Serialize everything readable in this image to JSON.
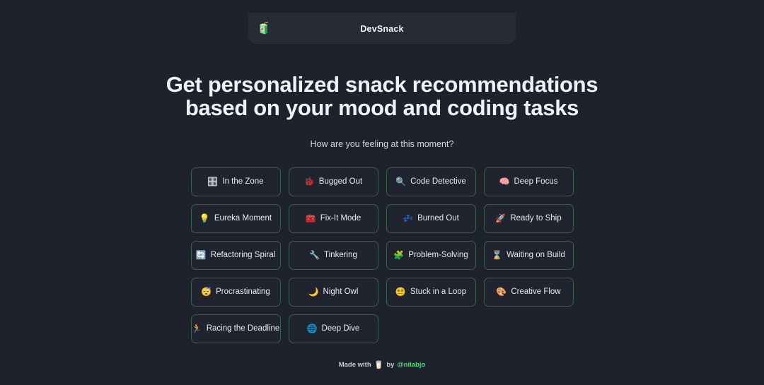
{
  "header": {
    "brand_icon": "snack-bag-emoji",
    "brand_icon_glyph": "🧃",
    "title": "DevSnack",
    "bar_color": "#272b35"
  },
  "hero": {
    "title_line1": "Get personalized snack recommendations",
    "title_line2": "based on your mood and coding tasks",
    "subtitle": "How are you feeling at this moment?"
  },
  "theme": {
    "background": "#1e222b",
    "button_background": "#20242e",
    "button_border": "#35614a",
    "accent_green": "#4ade80",
    "text_primary": "#eef1f7"
  },
  "moods": [
    {
      "label": "In the Zone",
      "icon_name": "control-knobs-icon",
      "glyph": "🎛️"
    },
    {
      "label": "Bugged Out",
      "icon_name": "lady-beetle-icon",
      "glyph": "🐞"
    },
    {
      "label": "Code Detective",
      "icon_name": "magnifying-glass-icon",
      "glyph": "🔍"
    },
    {
      "label": "Deep Focus",
      "icon_name": "brain-icon",
      "glyph": "🧠"
    },
    {
      "label": "Eureka Moment",
      "icon_name": "light-bulb-icon",
      "glyph": "💡"
    },
    {
      "label": "Fix-It Mode",
      "icon_name": "toolbox-icon",
      "glyph": "🧰"
    },
    {
      "label": "Burned Out",
      "icon_name": "zzz-sleep-icon",
      "glyph": "💤"
    },
    {
      "label": "Ready to Ship",
      "icon_name": "rocket-icon",
      "glyph": "🚀"
    },
    {
      "label": "Refactoring Spiral",
      "icon_name": "counterclockwise-arrows-icon",
      "glyph": "🔄"
    },
    {
      "label": "Tinkering",
      "icon_name": "wrench-icon",
      "glyph": "🔧"
    },
    {
      "label": "Problem-Solving",
      "icon_name": "puzzle-piece-icon",
      "glyph": "🧩"
    },
    {
      "label": "Waiting on Build",
      "icon_name": "hourglass-icon",
      "glyph": "⌛"
    },
    {
      "label": "Procrastinating",
      "icon_name": "sleeping-face-icon",
      "glyph": "😴"
    },
    {
      "label": "Night Owl",
      "icon_name": "crescent-moon-icon",
      "glyph": "🌙"
    },
    {
      "label": "Stuck in a Loop",
      "icon_name": "dizzy-face-icon",
      "glyph": "😵‍💫"
    },
    {
      "label": "Creative Flow",
      "icon_name": "artist-palette-icon",
      "glyph": "🎨"
    },
    {
      "label": "Racing the Deadline",
      "icon_name": "running-person-icon",
      "glyph": "🏃"
    },
    {
      "label": "Deep Dive",
      "icon_name": "globe-icon",
      "glyph": "🌐"
    }
  ],
  "footer": {
    "prefix": "Made with",
    "icon_name": "glass-of-milk-icon",
    "glyph": "🥛",
    "middle": "by",
    "handle": "@nilabjo"
  }
}
